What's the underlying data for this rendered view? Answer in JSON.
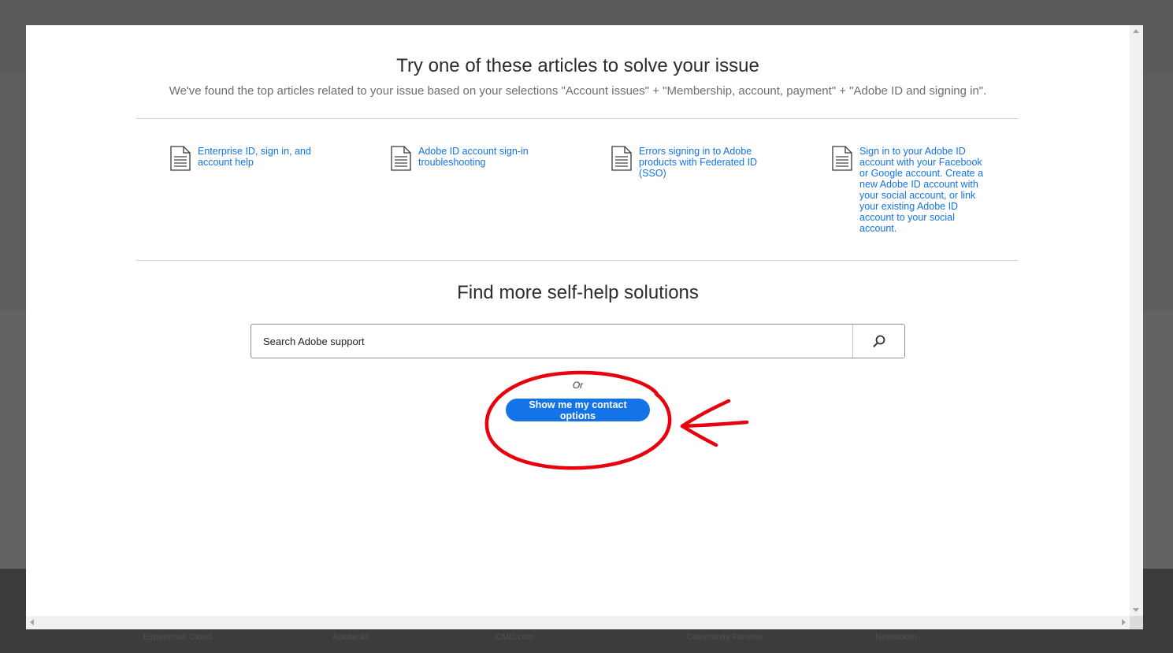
{
  "background": {
    "footer_links": [
      "Experience Cloud",
      "Adobe ID",
      "CMD.com",
      "Community Forums",
      "Newsroom"
    ]
  },
  "modal": {
    "headline": "Try one of these articles to solve your issue",
    "subtext": "We've found the top articles related to your issue based on your selections \"Account issues\" + \"Membership, account, payment\" + \"Adobe ID and signing in\".",
    "articles": [
      {
        "label": "Enterprise ID, sign in, and account help",
        "icon": "document-icon"
      },
      {
        "label": "Adobe ID account sign-in troubleshooting",
        "icon": "document-icon"
      },
      {
        "label": "Errors signing in to Adobe products with Federated ID (SSO)",
        "icon": "document-icon"
      },
      {
        "label": "Sign in to your Adobe ID account with your Facebook or Google account. Create a new Adobe ID account with your social account, or link your existing Adobe ID account to your social account.",
        "icon": "document-icon"
      }
    ],
    "self_help_title": "Find more self-help solutions",
    "search": {
      "placeholder": "Search Adobe support",
      "value": "",
      "icon": "search-icon"
    },
    "or_label": "Or",
    "contact_button_label": "Show me my contact options"
  },
  "colors": {
    "accent": "#1473e6",
    "annotation": "#e8000d",
    "overlay": "#5e5e5e"
  }
}
